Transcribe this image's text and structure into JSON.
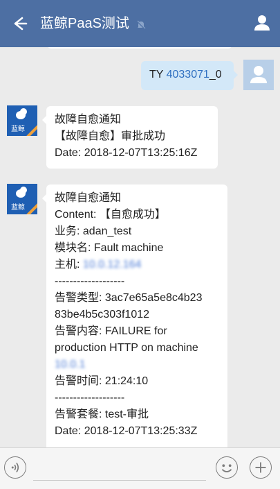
{
  "header": {
    "title": "蓝鲸PaaS测试",
    "icons": {
      "back": "arrow-left-icon",
      "mute": "mute-bell-icon",
      "profile": "person-icon"
    }
  },
  "bot_avatar_label": "蓝鲸",
  "messages": [
    {
      "sender": "user",
      "prefix": "TY ",
      "link": "4033071",
      "suffix": "_0"
    },
    {
      "sender": "bot",
      "lines": [
        "故障自愈通知",
        "【故障自愈】审批成功",
        "Date: 2018-12-07T13:25:16Z"
      ]
    },
    {
      "sender": "bot",
      "lines": [
        "故障自愈通知",
        "Content: 【自愈成功】",
        "业务: adan_test",
        "模块名: Fault machine",
        "主机:",
        "-------------------",
        "告警类型: 3ac7e65a5e8c4b23",
        "83be4b5c303f1012",
        "告警内容: FAILURE for",
        "production HTTP on machine",
        "告警时间: 21:24:10",
        "-------------------",
        "告警套餐: test-审批",
        "Date: 2018-12-07T13:25:33Z"
      ],
      "blurred_host": "10.0.12.164",
      "blurred_ip": "10.0.1"
    }
  ],
  "bottom": {
    "icons": [
      "voice-icon",
      "emoji-icon",
      "plus-icon"
    ]
  },
  "colors": {
    "header": "#4d6fa3",
    "incoming": "#ffffff",
    "outgoing": "#d3e8f8",
    "link": "#2f6fc0",
    "background": "#ebebeb"
  }
}
